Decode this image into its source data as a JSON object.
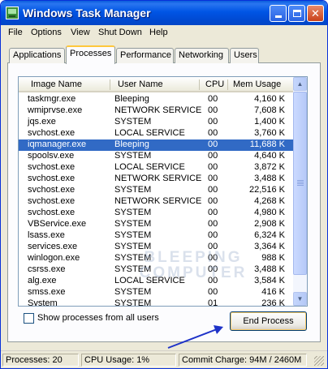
{
  "window": {
    "title": "Windows Task Manager"
  },
  "menu": [
    "File",
    "Options",
    "View",
    "Shut Down",
    "Help"
  ],
  "tabs": [
    {
      "label": "Applications",
      "active": false
    },
    {
      "label": "Processes",
      "active": true
    },
    {
      "label": "Performance",
      "active": false
    },
    {
      "label": "Networking",
      "active": false
    },
    {
      "label": "Users",
      "active": false
    }
  ],
  "table": {
    "columns": [
      "Image Name",
      "User Name",
      "CPU",
      "Mem Usage"
    ],
    "rows": [
      {
        "name": "taskmgr.exe",
        "user": "Bleeping",
        "cpu": "00",
        "mem": "4,160 K"
      },
      {
        "name": "wmiprvse.exe",
        "user": "NETWORK SERVICE",
        "cpu": "00",
        "mem": "7,608 K"
      },
      {
        "name": "jqs.exe",
        "user": "SYSTEM",
        "cpu": "00",
        "mem": "1,400 K"
      },
      {
        "name": "svchost.exe",
        "user": "LOCAL SERVICE",
        "cpu": "00",
        "mem": "3,760 K"
      },
      {
        "name": "iqmanager.exe",
        "user": "Bleeping",
        "cpu": "00",
        "mem": "11,688 K",
        "selected": true
      },
      {
        "name": "spoolsv.exe",
        "user": "SYSTEM",
        "cpu": "00",
        "mem": "4,640 K"
      },
      {
        "name": "svchost.exe",
        "user": "LOCAL SERVICE",
        "cpu": "00",
        "mem": "3,872 K"
      },
      {
        "name": "svchost.exe",
        "user": "NETWORK SERVICE",
        "cpu": "00",
        "mem": "3,488 K"
      },
      {
        "name": "svchost.exe",
        "user": "SYSTEM",
        "cpu": "00",
        "mem": "22,516 K"
      },
      {
        "name": "svchost.exe",
        "user": "NETWORK SERVICE",
        "cpu": "00",
        "mem": "4,268 K"
      },
      {
        "name": "svchost.exe",
        "user": "SYSTEM",
        "cpu": "00",
        "mem": "4,980 K"
      },
      {
        "name": "VBService.exe",
        "user": "SYSTEM",
        "cpu": "00",
        "mem": "2,908 K"
      },
      {
        "name": "lsass.exe",
        "user": "SYSTEM",
        "cpu": "00",
        "mem": "6,324 K"
      },
      {
        "name": "services.exe",
        "user": "SYSTEM",
        "cpu": "00",
        "mem": "3,364 K"
      },
      {
        "name": "winlogon.exe",
        "user": "SYSTEM",
        "cpu": "00",
        "mem": "988 K"
      },
      {
        "name": "csrss.exe",
        "user": "SYSTEM",
        "cpu": "00",
        "mem": "3,488 K"
      },
      {
        "name": "alg.exe",
        "user": "LOCAL SERVICE",
        "cpu": "00",
        "mem": "3,584 K"
      },
      {
        "name": "smss.exe",
        "user": "SYSTEM",
        "cpu": "00",
        "mem": "416 K"
      },
      {
        "name": "System",
        "user": "SYSTEM",
        "cpu": "01",
        "mem": "236 K"
      }
    ]
  },
  "watermark": [
    "BLEEPING",
    "COMPUTER"
  ],
  "show_all_processes_label": "Show processes from all users",
  "end_process_label": "End Process",
  "status": {
    "processes": "Processes: 20",
    "cpu_usage": "CPU Usage: 1%",
    "commit_charge": "Commit Charge: 94M / 2460M"
  },
  "icons": {
    "app": "task-manager-icon",
    "minimize": "minimize-icon",
    "maximize": "maximize-icon",
    "close": "close-icon",
    "scroll_up": "scroll-up-arrow-icon",
    "scroll_down": "scroll-down-arrow-icon",
    "annotation": "blue-arrow-icon"
  },
  "colors": {
    "title_bar": "#0055e5",
    "selection": "#316ac5",
    "annotation_arrow": "#1e32c8"
  }
}
